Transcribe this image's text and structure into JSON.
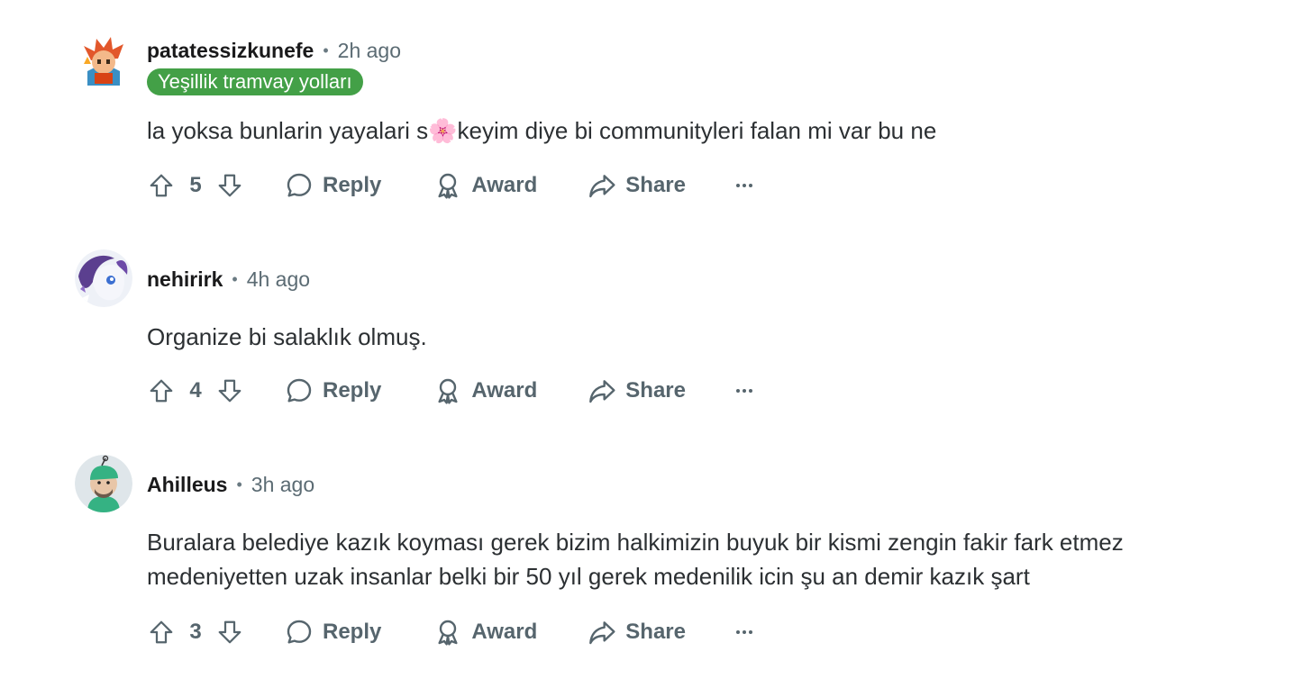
{
  "comments": [
    {
      "username": "patatessizkunefe",
      "time": "2h ago",
      "flair": "Yeşillik tramvay yolları",
      "body": "la yoksa bunlarin yayalari s🌸keyim diye bi communityleri falan mi var bu ne",
      "score": "5",
      "reply_label": "Reply",
      "award_label": "Award",
      "share_label": "Share"
    },
    {
      "username": "nehirirk",
      "time": "4h ago",
      "body": "Organize bi salaklık olmuş.",
      "score": "4",
      "reply_label": "Reply",
      "award_label": "Award",
      "share_label": "Share"
    },
    {
      "username": "Ahilleus",
      "time": "3h ago",
      "body": "Buralara belediye kazık koyması gerek bizim halkimizin buyuk bir kismi zengin fakir fark etmez medeniyetten uzak insanlar belki bir 50 yıl gerek medenilik icin şu an demir kazık şart",
      "score": "3",
      "reply_label": "Reply",
      "award_label": "Award",
      "share_label": "Share"
    }
  ],
  "colors": {
    "flair_bg": "#43a047",
    "action_gray": "#56656d",
    "meta_gray": "#5b6b73"
  }
}
